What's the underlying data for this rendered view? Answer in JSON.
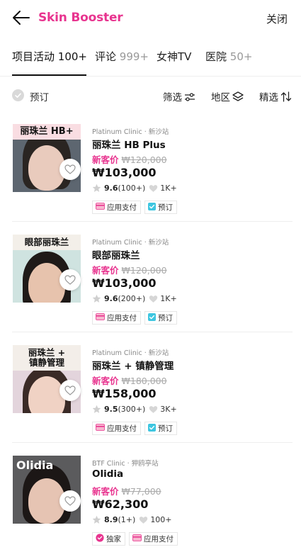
{
  "header": {
    "title": "Skin Booster",
    "close_label": "关闭"
  },
  "tabs": [
    {
      "label": "项目活动",
      "count": "100+",
      "active": true
    },
    {
      "label": "评论",
      "count": "999+",
      "active": false
    },
    {
      "label": "女神TV",
      "count": "",
      "active": false
    },
    {
      "label": "医院",
      "count": "50+",
      "active": false
    }
  ],
  "filters": {
    "book_label": "预订",
    "filter_label": "筛选",
    "region_label": "地区",
    "sort_label": "精选"
  },
  "colors": {
    "brand": "#e8348f",
    "strike": "#aaaaaa",
    "teal": "#3ec6e0"
  },
  "products": [
    {
      "banner": "丽珠兰 HB+",
      "clinic": "Platinum Clinic",
      "station": "新沙站",
      "name": "丽珠兰 HB Plus",
      "new_label": "新客价",
      "original_price": "₩120,000",
      "price": "₩103,000",
      "score": "9.6",
      "reviews": "(100+)",
      "likes": "1K+",
      "badges": [
        "应用支付",
        "预订"
      ]
    },
    {
      "banner": "眼部丽珠兰",
      "clinic": "Platinum Clinic",
      "station": "新沙站",
      "name": "眼部丽珠兰",
      "new_label": "新客价",
      "original_price": "₩120,000",
      "price": "₩103,000",
      "score": "9.6",
      "reviews": "(200+)",
      "likes": "1K+",
      "badges": [
        "应用支付",
        "预订"
      ]
    },
    {
      "banner": "丽珠兰 +\n镇静管理",
      "clinic": "Platinum Clinic",
      "station": "新沙站",
      "name": "丽珠兰 + 镇静管理",
      "new_label": "新客价",
      "original_price": "₩180,000",
      "price": "₩158,000",
      "score": "9.5",
      "reviews": "(300+)",
      "likes": "3K+",
      "badges": [
        "应用支付",
        "预订"
      ]
    },
    {
      "banner": "Olidia",
      "clinic": "BTF Clinic",
      "station": "狎鸥亭站",
      "name": "Olidia",
      "new_label": "新客价",
      "original_price": "₩77,000",
      "price": "₩62,300",
      "score": "8.9",
      "reviews": "(1+)",
      "likes": "100+",
      "badges": [
        "独家",
        "应用支付"
      ]
    }
  ]
}
